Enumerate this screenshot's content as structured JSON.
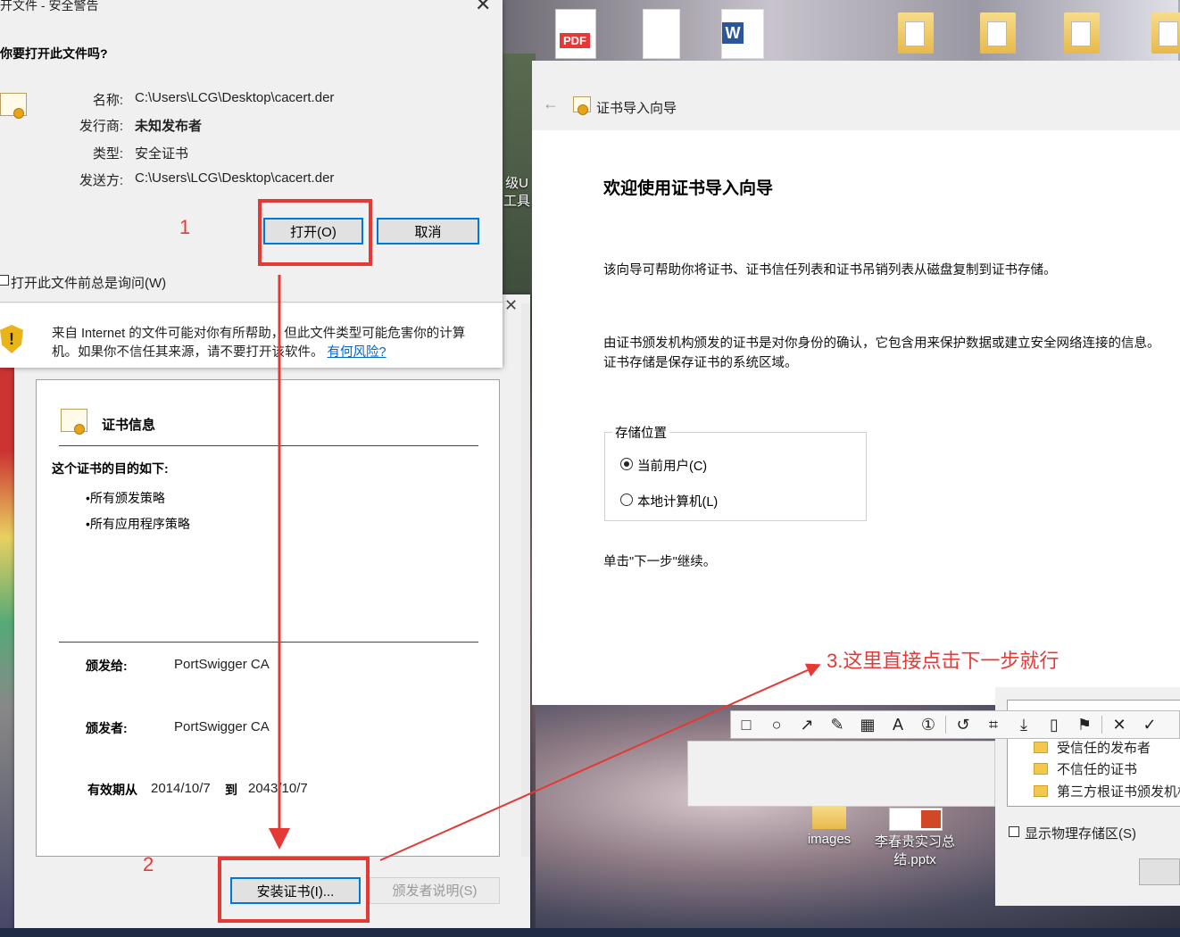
{
  "security_dialog": {
    "title": "开文件 - 安全警告",
    "question": "你要打开此文件吗?",
    "fields": [
      {
        "label": "名称:",
        "value": "C:\\Users\\LCG\\Desktop\\cacert.der"
      },
      {
        "label": "发行商:",
        "value": "未知发布者"
      },
      {
        "label": "类型:",
        "value": "安全证书"
      },
      {
        "label": "发送方:",
        "value": "C:\\Users\\LCG\\Desktop\\cacert.der"
      }
    ],
    "open_button": "打开(O)",
    "cancel_button": "取消",
    "always_ask_checkbox": "打开此文件前总是询问(W)",
    "warning_text": "来自 Internet 的文件可能对你有所帮助，但此文件类型可能危害你的计算机。如果你不信任其来源，请不要打开该软件。",
    "risk_link": "有何风险?"
  },
  "cert_dialog": {
    "section_title": "证书信息",
    "purpose_heading": "这个证书的目的如下:",
    "purposes": [
      "•所有颁发策略",
      "•所有应用程序策略"
    ],
    "issued_to_label": "颁发给:",
    "issued_to_value": "PortSwigger CA",
    "issued_by_label": "颁发者:",
    "issued_by_value": "PortSwigger CA",
    "valid_from_label": "有效期从",
    "valid_from_value": "2014/10/7",
    "valid_to_label": "到",
    "valid_to_value": "2043/10/7",
    "install_button": "安装证书(I)...",
    "issuer_statement_button": "颁发者说明(S)"
  },
  "wizard": {
    "title": "证书导入向导",
    "heading": "欢迎使用证书导入向导",
    "para1": "该向导可帮助你将证书、证书信任列表和证书吊销列表从磁盘复制到证书存储。",
    "para2": "由证书颁发机构颁发的证书是对你身份的确认，它包含用来保护数据或建立安全网络连接的信息。证书存储是保存证书的系统区域。",
    "store_legend": "存储位置",
    "option_current_user": "当前用户(C)",
    "option_local_machine": "本地计算机(L)",
    "continue_text": "单击\"下一步\"继续。"
  },
  "desktop": {
    "pdf_badge": "PDF",
    "word_badge": "W",
    "side_label_1": "级U",
    "side_label_2": "工具",
    "images_label": "images",
    "pptx_label_1": "李春贵实习总",
    "pptx_label_2": "结.pptx"
  },
  "cert_store": {
    "items": [
      "受信任的发布者",
      "不信任的证书",
      "第三方根证书颁发机构"
    ],
    "show_physical": "显示物理存储区(S)"
  },
  "annotations": {
    "step1": "1",
    "step2": "2",
    "step3": "3.这里直接点击下一步就行"
  },
  "colors": {
    "annotation_red": "#e53935",
    "accent_blue": "#0078d7"
  }
}
